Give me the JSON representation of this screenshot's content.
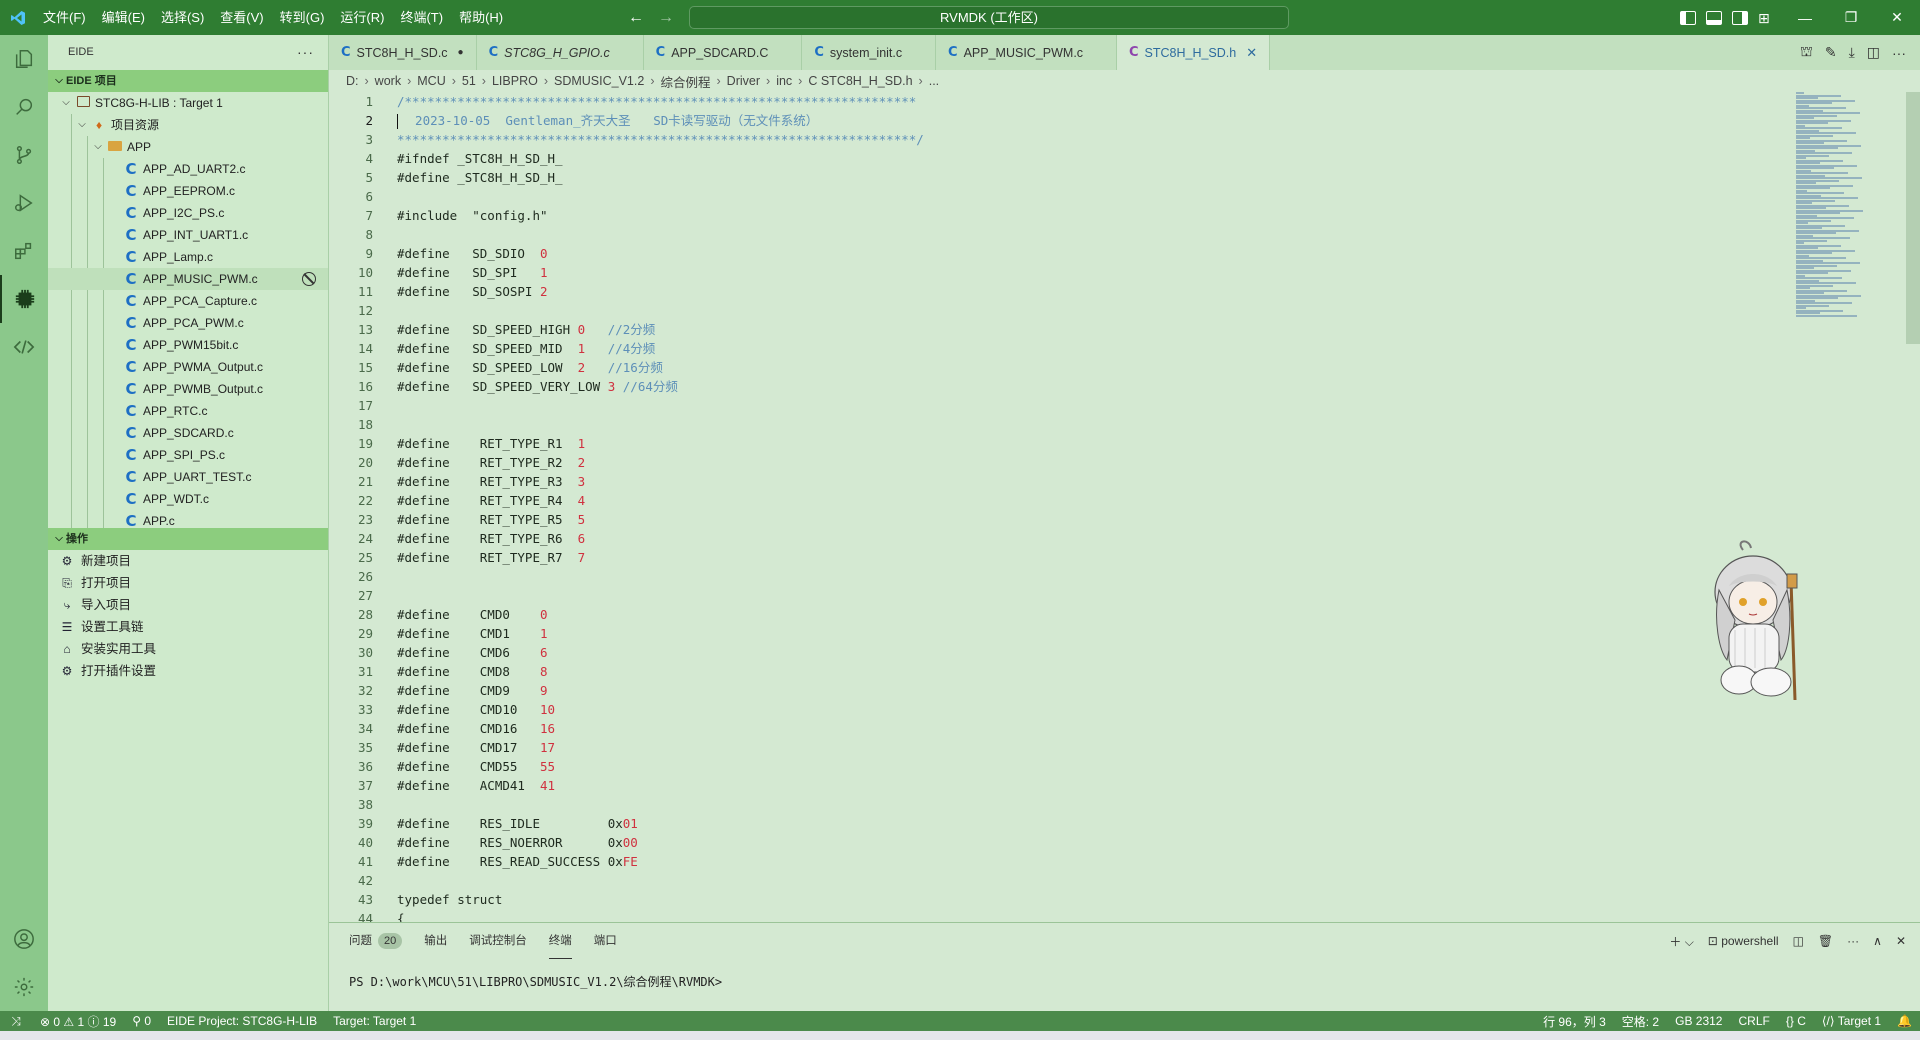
{
  "titlebar": {
    "menus": [
      "文件(F)",
      "编辑(E)",
      "选择(S)",
      "查看(V)",
      "转到(G)",
      "运行(R)",
      "终端(T)",
      "帮助(H)"
    ],
    "command_center": "RVMDK (工作区)"
  },
  "sidebar": {
    "header": "EIDE",
    "section_project": "EIDE 项目",
    "project_name": "STC8G-H-LIB : Target 1",
    "resources_label": "项目资源",
    "folder_app": "APP",
    "files": [
      "APP_AD_UART2.c",
      "APP_EEPROM.c",
      "APP_I2C_PS.c",
      "APP_INT_UART1.c",
      "APP_Lamp.c",
      "APP_MUSIC_PWM.c",
      "APP_PCA_Capture.c",
      "APP_PCA_PWM.c",
      "APP_PWM15bit.c",
      "APP_PWMA_Output.c",
      "APP_PWMB_Output.c",
      "APP_RTC.c",
      "APP_SDCARD.c",
      "APP_SPI_PS.c",
      "APP_UART_TEST.c",
      "APP_WDT.c",
      "APP.c"
    ],
    "selected_file_index": 5,
    "section_ops": "操作",
    "ops": [
      "新建项目",
      "打开项目",
      "导入项目",
      "设置工具链",
      "安装实用工具",
      "打开插件设置"
    ]
  },
  "tabs": [
    {
      "label": "STC8H_H_SD.c",
      "kind": "c",
      "dirty": true,
      "italic": false,
      "active": false
    },
    {
      "label": "STC8G_H_GPIO.c",
      "kind": "c",
      "dirty": false,
      "italic": true,
      "active": false
    },
    {
      "label": "APP_SDCARD.C",
      "kind": "c",
      "dirty": false,
      "italic": false,
      "active": false
    },
    {
      "label": "system_init.c",
      "kind": "c",
      "dirty": false,
      "italic": false,
      "active": false
    },
    {
      "label": "APP_MUSIC_PWM.c",
      "kind": "c",
      "dirty": false,
      "italic": false,
      "active": false
    },
    {
      "label": "STC8H_H_SD.h",
      "kind": "h",
      "dirty": false,
      "italic": false,
      "active": true
    }
  ],
  "breadcrumb": [
    "D:",
    "work",
    "MCU",
    "51",
    "LIBPRO",
    "SDMUSIC_V1.2",
    "综合例程",
    "Driver",
    "inc",
    "C STC8H_H_SD.h",
    "..."
  ],
  "editor": {
    "current_line": 2,
    "lines": [
      "/********************************************************************",
      "  2023-10-05  Gentleman_齐天大圣   SD卡读写驱动（无文件系统）",
      "*********************************************************************/",
      "#ifndef _STC8H_H_SD_H_",
      "#define _STC8H_H_SD_H_",
      "",
      "#include  \"config.h\"",
      "",
      "#define   SD_SDIO  0",
      "#define   SD_SPI   1",
      "#define   SD_SOSPI 2",
      "",
      "#define   SD_SPEED_HIGH 0   //2分频",
      "#define   SD_SPEED_MID  1   //4分频",
      "#define   SD_SPEED_LOW  2   //16分频",
      "#define   SD_SPEED_VERY_LOW 3 //64分频",
      "",
      "",
      "#define    RET_TYPE_R1  1",
      "#define    RET_TYPE_R2  2",
      "#define    RET_TYPE_R3  3",
      "#define    RET_TYPE_R4  4",
      "#define    RET_TYPE_R5  5",
      "#define    RET_TYPE_R6  6",
      "#define    RET_TYPE_R7  7",
      "",
      "",
      "#define    CMD0    0",
      "#define    CMD1    1",
      "#define    CMD6    6",
      "#define    CMD8    8",
      "#define    CMD9    9",
      "#define    CMD10   10",
      "#define    CMD16   16",
      "#define    CMD17   17",
      "#define    CMD55   55",
      "#define    ACMD41  41",
      "",
      "#define    RES_IDLE         0x01",
      "#define    RES_NOERROR      0x00",
      "#define    RES_READ_SUCCESS 0xFE",
      "",
      "typedef struct",
      "{"
    ]
  },
  "panel": {
    "tabs": [
      "问题",
      "输出",
      "调试控制台",
      "终端",
      "端口"
    ],
    "problems_count": "20",
    "active_tab_index": 3,
    "shell": "powershell",
    "terminal_prompt": "PS D:\\work\\MCU\\51\\LIBPRO\\SDMUSIC_V1.2\\综合例程\\RVMDK>"
  },
  "statusbar": {
    "errors": "0",
    "warnings": "1",
    "infos": "19",
    "ports": "0",
    "project": "EIDE Project: STC8G-H-LIB",
    "target": "Target: Target 1",
    "position": "行 96，列 3",
    "spaces": "空格: 2",
    "encoding": "GB 2312",
    "eol": "CRLF",
    "language": "C",
    "target_right": "Target 1"
  },
  "colors": {
    "titlebar": "#2f7d32",
    "activitybar": "#8bc88b",
    "sidebar": "#cfeacc",
    "editor": "#d4e9d2",
    "statusbar": "#4b8a4b",
    "section_header": "#8ccd7e",
    "c_icon": "#1d6fc4",
    "number": "#d0313f",
    "comment": "#5d8fb8"
  }
}
